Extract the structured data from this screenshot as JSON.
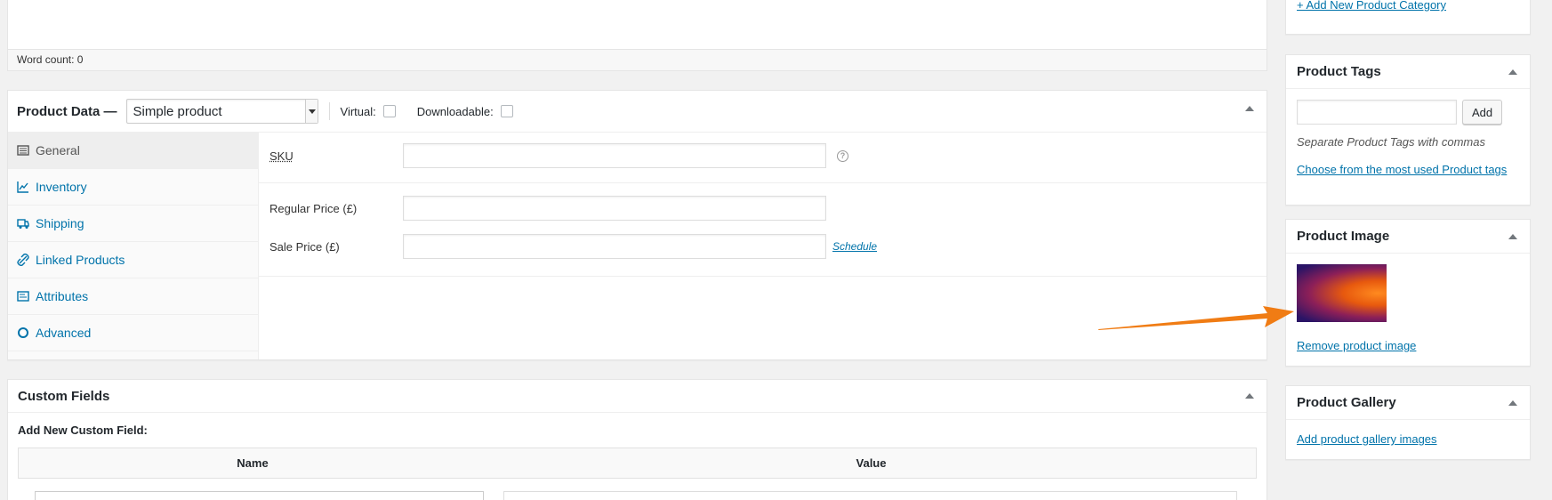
{
  "editor": {
    "word_count": "Word count: 0"
  },
  "product_data": {
    "title": "Product Data —",
    "type_select": "Simple product",
    "virtual_label": "Virtual:",
    "downloadable_label": "Downloadable:",
    "tabs": [
      {
        "label": "General",
        "icon": "table-icon"
      },
      {
        "label": "Inventory",
        "icon": "chart-icon"
      },
      {
        "label": "Shipping",
        "icon": "truck-icon"
      },
      {
        "label": "Linked Products",
        "icon": "link-icon"
      },
      {
        "label": "Attributes",
        "icon": "list-icon"
      },
      {
        "label": "Advanced",
        "icon": "gear-icon"
      }
    ],
    "fields": {
      "sku_label": "SKU",
      "regular_price_label": "Regular Price (£)",
      "sale_price_label": "Sale Price (£)",
      "schedule_link": "Schedule",
      "help_glyph": "?"
    }
  },
  "custom_fields": {
    "title": "Custom Fields",
    "subtitle": "Add New Custom Field:",
    "col_name": "Name",
    "col_value": "Value"
  },
  "sidebar": {
    "add_category_link": "+ Add New Product Category",
    "tags": {
      "title": "Product Tags",
      "add_button": "Add",
      "hint": "Separate Product Tags with commas",
      "choose_link": "Choose from the most used Product tags"
    },
    "image": {
      "title": "Product Image",
      "remove_link": "Remove product image"
    },
    "gallery": {
      "title": "Product Gallery",
      "add_link": "Add product gallery images"
    }
  },
  "colors": {
    "link": "#0073aa",
    "arrow": "#f07c14"
  }
}
